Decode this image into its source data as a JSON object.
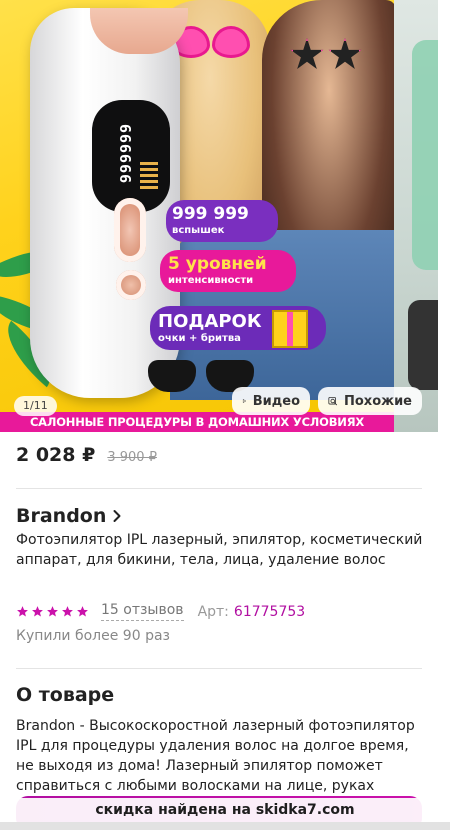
{
  "gallery": {
    "counter": "1/11",
    "video_label": "Видео",
    "similar_label": "Похожие",
    "banner_count": "999 999",
    "banner_count_sub": "вспышек",
    "banner_levels": "5 уровней",
    "banner_levels_sub": "интенсивности",
    "banner_gift": "ПОДАРОК",
    "banner_gift_sub": "очки + бритва",
    "strip_text": "САЛОННЫЕ ПРОЦЕДУРЫ В ДОМАШНИХ УСЛОВИЯХ",
    "screen_digits": "999999"
  },
  "product": {
    "price": "2 028 ₽",
    "old_price": "3 900 ₽",
    "brand": "Brandon",
    "title": "Фотоэпилятор IPL лазерный, эпилятор, косметический аппарат, для бикини, тела, лица, удаление волос",
    "rating_stars": 5,
    "reviews": "15 отзывов",
    "article_label": "Арт:",
    "article_value": "61775753",
    "bought": "Купили более 90 раз"
  },
  "about": {
    "title": "О товаре",
    "description": "Brandon - Высокоскоростной лазерный фотоэпилятор IPL для процедуры удаления волос на долгое время, не выходя из дома! Лазерный эпилятор поможет справиться с любыми волосками на лице, руках"
  },
  "promo": {
    "text": "скидка найдена на skidka7.com"
  },
  "colors": {
    "accent": "#cb11ab",
    "banner_pink": "#e8199a",
    "banner_purple": "#6c2bb8",
    "art_link": "#b10fa1"
  }
}
